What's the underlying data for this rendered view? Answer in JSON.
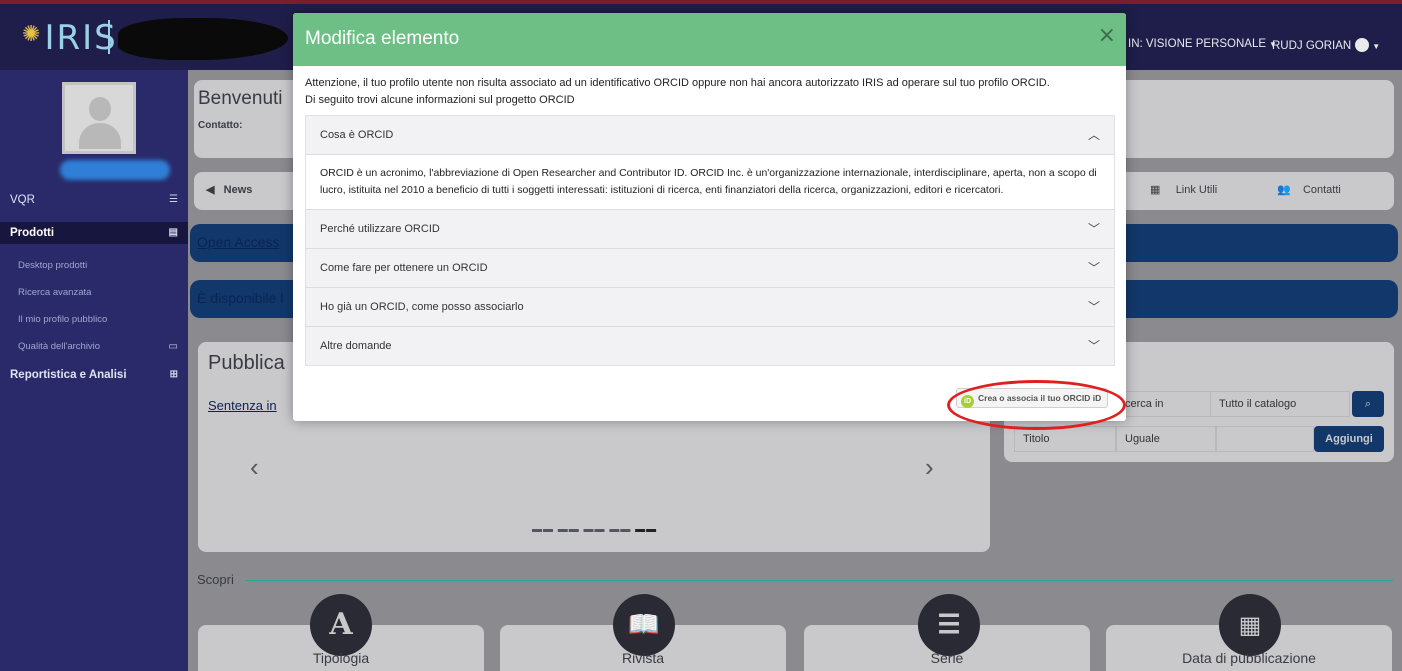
{
  "topbar": {
    "logo": "IRIS",
    "view_menu": "IN: VISIONE PERSONALE",
    "user_menu": "RUDJ GORIAN"
  },
  "sidebar": {
    "vqr": "VQR",
    "prodotti": "Prodotti",
    "sub_items": [
      "Desktop prodotti",
      "Ricerca avanzata",
      "Il mio profilo pubblico",
      "Qualità dell'archivio"
    ],
    "reportistica": "Reportistica e Analisi"
  },
  "background": {
    "welcome": "Benvenuti",
    "contact_label": "Contatto:",
    "news_tab": "News",
    "link_utili": "Link Utili",
    "contatti": "Contatti",
    "open_access": "Open Access",
    "disponibile": "È disponibile l",
    "pubblicazioni": "Pubblica",
    "sentenza": "Sentenza in",
    "search_label": "cerca in",
    "search_scope": "Tutto il catalogo",
    "filter_field": "Titolo",
    "filter_op": "Uguale",
    "add_button": "Aggiungi",
    "scopri": "Scopri",
    "tiles": [
      "Tipologia",
      "Rivista",
      "Serie",
      "Data di pubblicazione"
    ]
  },
  "modal": {
    "title": "Modifica elemento",
    "close": "×",
    "intro_line1": "Attenzione, il tuo profilo utente non risulta associato ad un identificativo ORCID oppure non hai ancora autorizzato IRIS ad operare sul tuo profilo ORCID.",
    "intro_line2": "Di seguito trovi alcune informazioni sul progetto ORCID",
    "accordion": [
      {
        "title": "Cosa è ORCID",
        "expanded": true,
        "body": "ORCID è un acronimo, l'abbreviazione di Open Researcher and Contributor ID. ORCID Inc. è un'organizzazione internazionale, interdisciplinare, aperta, non a scopo di lucro, istituita nel 2010 a beneficio di tutti i soggetti interessati: istituzioni di ricerca, enti finanziatori della ricerca, organizzazioni, editori e ricercatori."
      },
      {
        "title": "Perché utilizzare ORCID",
        "expanded": false
      },
      {
        "title": "Come fare per ottenere un ORCID",
        "expanded": false
      },
      {
        "title": "Ho già un ORCID, come posso associarlo",
        "expanded": false
      },
      {
        "title": "Altre domande",
        "expanded": false
      }
    ],
    "orcid_badge": "iD",
    "orcid_button": "Crea o associa il tuo ORCID iD"
  },
  "colors": {
    "modal_header": "#6dbf86",
    "sidebar": "#2a2a6a",
    "highlight": "#e02020"
  }
}
